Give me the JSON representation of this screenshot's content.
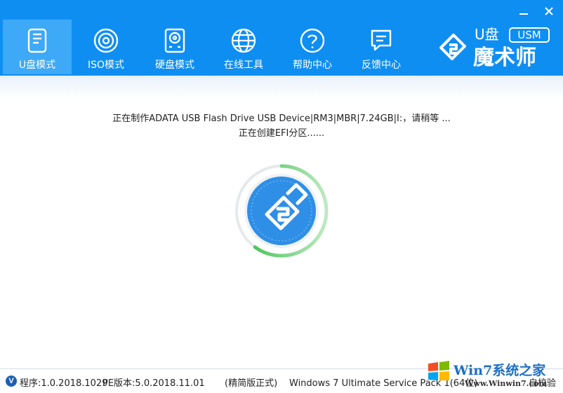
{
  "window": {
    "minimize_icon": "minimize-icon",
    "close_icon": "close-icon"
  },
  "nav": {
    "items": [
      {
        "label": "U盘模式",
        "icon": "usb-drive-icon",
        "active": true
      },
      {
        "label": "ISO模式",
        "icon": "disc-icon",
        "active": false
      },
      {
        "label": "硬盘模式",
        "icon": "hard-disk-icon",
        "active": false
      },
      {
        "label": "在线工具",
        "icon": "globe-icon",
        "active": false
      },
      {
        "label": "帮助中心",
        "icon": "help-icon",
        "active": false
      },
      {
        "label": "反馈中心",
        "icon": "feedback-icon",
        "active": false
      }
    ]
  },
  "brand": {
    "text_top": "U盘",
    "text_badge": "USM",
    "text_main": "魔术师"
  },
  "status": {
    "line1": "正在制作ADATA USB Flash Drive USB Device|RM3|MBR|7.24GB|I:，请稍等 ...",
    "line2": "正在创建EFI分区......",
    "progress_fraction": 0.6
  },
  "footer": {
    "badge": "V",
    "program_version": "程序:1.0.2018.1029",
    "pe_version": "PE版本:5.0.2018.11.01",
    "edition": "(精简版正式)",
    "os": "Windows 7 Ultimate Service Pack 1(64位)",
    "verify": "自校验"
  },
  "watermark": {
    "brand": "Win7系统之家",
    "url": "Www.Winwin7.com"
  },
  "colors": {
    "header_bg": "#0f8ef2",
    "nav_active_bg": "#3da9f7",
    "spinner_blue": "#2f8fe6",
    "progress_green": "#3ec34a"
  }
}
